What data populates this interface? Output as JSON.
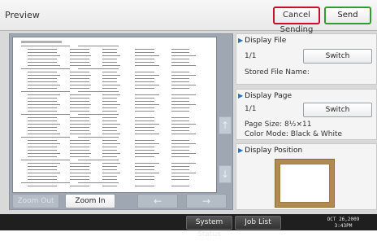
{
  "header": {
    "title": "Preview",
    "cancel_label": "Cancel Sending",
    "send_label": "Send"
  },
  "preview": {
    "zoom_out_label": "Zoom Out",
    "zoom_in_label": "Zoom In",
    "scroll_up_icon": "up-arrow-icon",
    "scroll_down_icon": "down-arrow-icon",
    "prev_icon": "left-arrow-icon",
    "next_icon": "right-arrow-icon"
  },
  "display_file": {
    "title": "Display File",
    "counter": "1/1",
    "switch_label": "Switch",
    "stored_name_label": "Stored File Name:"
  },
  "display_page": {
    "title": "Display Page",
    "counter": "1/1",
    "switch_label": "Switch",
    "page_size": "Page Size: 8½×11",
    "color_mode": "Color Mode: Black & White"
  },
  "display_position": {
    "title": "Display Position"
  },
  "status_bar": {
    "system_status_label": "System Status",
    "job_list_label": "Job List",
    "date": "OCT  26,2009",
    "time": "3:43PM"
  },
  "colors": {
    "cancel_border": "#c8102e",
    "send_border": "#2e9e2e",
    "accent": "#2f6fba"
  }
}
